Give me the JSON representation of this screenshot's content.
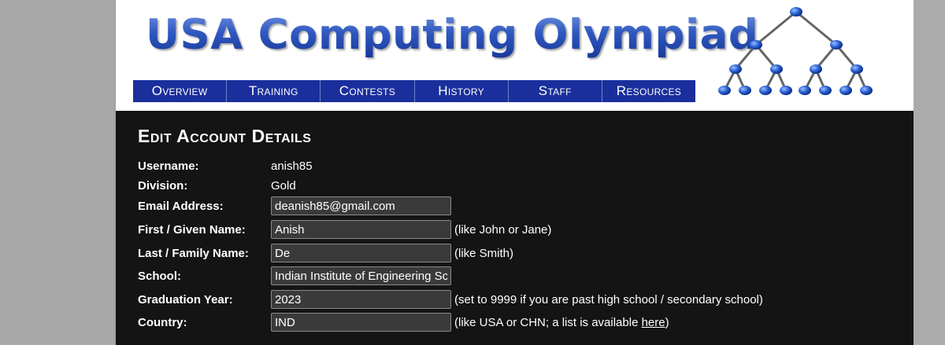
{
  "site": {
    "logo_text": "USA Computing Olympiad"
  },
  "nav": [
    {
      "label": "Overview"
    },
    {
      "label": "Training"
    },
    {
      "label": "Contests"
    },
    {
      "label": "History"
    },
    {
      "label": "Staff"
    },
    {
      "label": "Resources"
    }
  ],
  "page": {
    "title": "Edit Account Details"
  },
  "account": {
    "username": {
      "label": "Username:",
      "value": "anish85"
    },
    "division": {
      "label": "Division:",
      "value": "Gold"
    },
    "email": {
      "label": "Email Address:",
      "value": "deanish85@gmail.com"
    },
    "first_name": {
      "label": "First / Given Name:",
      "value": "Anish",
      "hint": "(like John or Jane)"
    },
    "last_name": {
      "label": "Last / Family Name:",
      "value": "De",
      "hint": "(like Smith)"
    },
    "school": {
      "label": "School:",
      "value": "Indian Institute of Engineering Sc"
    },
    "graduation_year": {
      "label": "Graduation Year:",
      "value": "2023",
      "hint": "(set to 9999 if you are past high school / secondary school)"
    },
    "country": {
      "label": "Country:",
      "value": "IND",
      "hint_before": "(like USA or CHN; a list is available ",
      "hint_link": "here",
      "hint_after": ")"
    }
  },
  "colors": {
    "nav_bg": "#1a2f9c",
    "logo_blue": "#2f58c0",
    "content_bg": "#141414"
  },
  "icons": {
    "logo_graphic": "binary-tree-icon"
  }
}
